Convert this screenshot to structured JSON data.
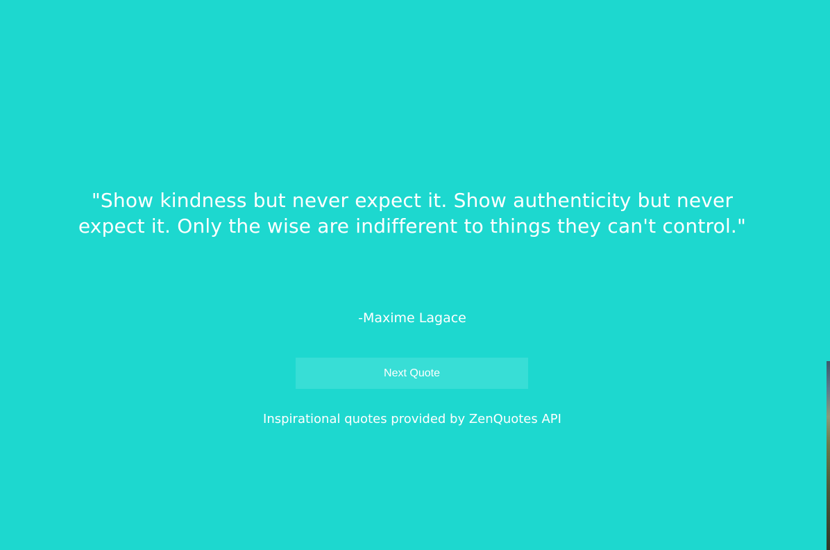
{
  "quote": {
    "text": "\"Show kindness but never expect it. Show authenticity but never expect it. Only the wise are indifferent to things they can't control.\"",
    "author": "-Maxime Lagace"
  },
  "actions": {
    "next_label": "Next Quote"
  },
  "footer": {
    "credit": "Inspirational quotes provided by ZenQuotes API"
  },
  "colors": {
    "background": "#1dd8cf",
    "button_background": "#38ded6",
    "text": "#ffffff"
  }
}
